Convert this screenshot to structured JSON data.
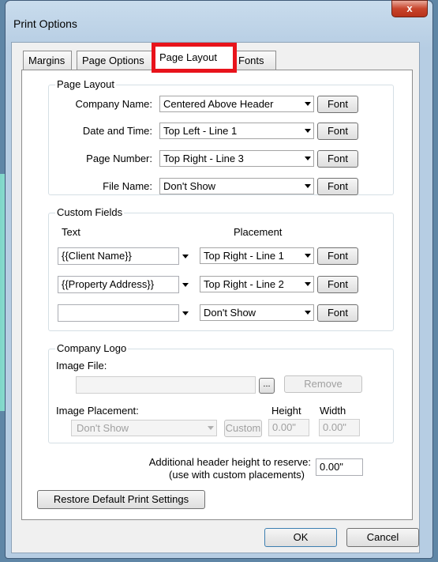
{
  "window": {
    "title": "Print Options",
    "close_glyph": "x"
  },
  "tabs": [
    {
      "label": "Margins",
      "active": false
    },
    {
      "label": "Page Options",
      "active": false
    },
    {
      "label": "Page Layout",
      "active": true
    },
    {
      "label": "Fonts",
      "active": false
    }
  ],
  "page_layout": {
    "legend": "Page Layout",
    "rows": [
      {
        "label": "Company Name:",
        "value": "Centered Above Header",
        "font": "Font"
      },
      {
        "label": "Date and Time:",
        "value": "Top Left - Line 1",
        "font": "Font"
      },
      {
        "label": "Page Number:",
        "value": "Top Right - Line 3",
        "font": "Font"
      },
      {
        "label": "File Name:",
        "value": "Don't Show",
        "font": "Font"
      }
    ]
  },
  "custom_fields": {
    "legend": "Custom Fields",
    "text_header": "Text",
    "placement_header": "Placement",
    "rows": [
      {
        "text": "{{Client Name}}",
        "placement": "Top Right - Line 1",
        "font": "Font"
      },
      {
        "text": "{{Property Address}}",
        "placement": "Top Right - Line 2",
        "font": "Font"
      },
      {
        "text": "",
        "placement": "Don't Show",
        "font": "Font"
      }
    ]
  },
  "company_logo": {
    "legend": "Company Logo",
    "image_file_label": "Image File:",
    "image_file_value": "",
    "browse_label": "...",
    "remove_label": "Remove",
    "placement_label": "Image Placement:",
    "placement_value": "Don't Show",
    "height_label": "Height",
    "width_label": "Width",
    "custom_label": "Custom",
    "height_value": "0.00\"",
    "width_value": "0.00\""
  },
  "additional_header": {
    "line1": "Additional header height to reserve:",
    "line2": "(use with custom placements)",
    "value": "0.00\""
  },
  "restore_button": "Restore Default Print Settings",
  "ok_button": "OK",
  "cancel_button": "Cancel",
  "colors": {
    "highlight": "#e8131b",
    "close_button": "#c8452c"
  }
}
